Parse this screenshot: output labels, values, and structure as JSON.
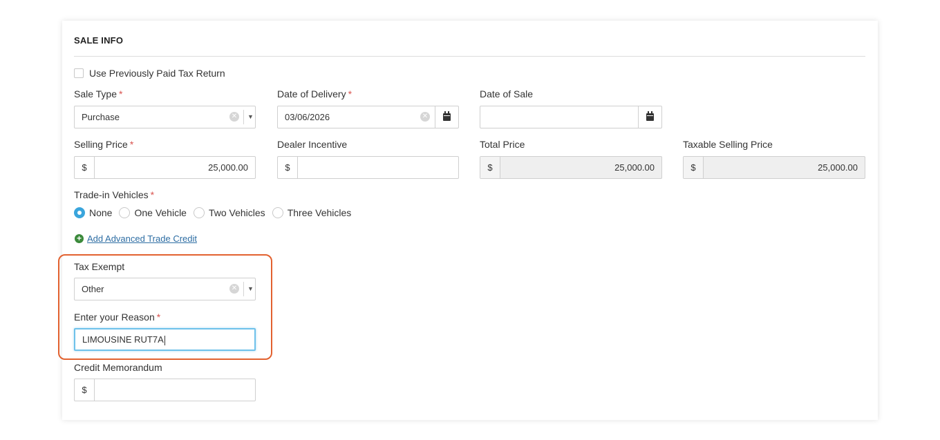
{
  "section": {
    "title": "SALE INFO"
  },
  "use_prev_tax": {
    "label": "Use Previously Paid Tax Return",
    "checked": false
  },
  "sale_type": {
    "label": "Sale Type",
    "required_mark": "*",
    "value": "Purchase"
  },
  "date_of_delivery": {
    "label": "Date of Delivery",
    "required_mark": "*",
    "value": "03/06/2026"
  },
  "date_of_sale": {
    "label": "Date of Sale",
    "value": ""
  },
  "selling_price": {
    "label": "Selling Price",
    "required_mark": "*",
    "currency": "$",
    "value": "25,000.00"
  },
  "dealer_incentive": {
    "label": "Dealer Incentive",
    "currency": "$",
    "value": ""
  },
  "total_price": {
    "label": "Total Price",
    "currency": "$",
    "value": "25,000.00"
  },
  "taxable_selling_price": {
    "label": "Taxable Selling Price",
    "currency": "$",
    "value": "25,000.00"
  },
  "trade_in": {
    "label": "Trade-in Vehicles",
    "required_mark": "*",
    "options": [
      "None",
      "One Vehicle",
      "Two Vehicles",
      "Three Vehicles"
    ],
    "selected": "None"
  },
  "advanced_trade": {
    "label": "Add Advanced Trade Credit"
  },
  "tax_exempt": {
    "label": "Tax Exempt",
    "value": "Other"
  },
  "reason": {
    "label": "Enter your Reason",
    "required_mark": "*",
    "value": "LIMOUSINE RUT7A"
  },
  "credit_memo": {
    "label": "Credit Memorandum",
    "currency": "$",
    "value": ""
  },
  "colors": {
    "required": "#d9534f",
    "highlight": "#e2612f",
    "focus": "#6ec1ea",
    "radio_on": "#3aa5dc",
    "link": "#2d6da3",
    "plus": "#3b8a3b"
  }
}
